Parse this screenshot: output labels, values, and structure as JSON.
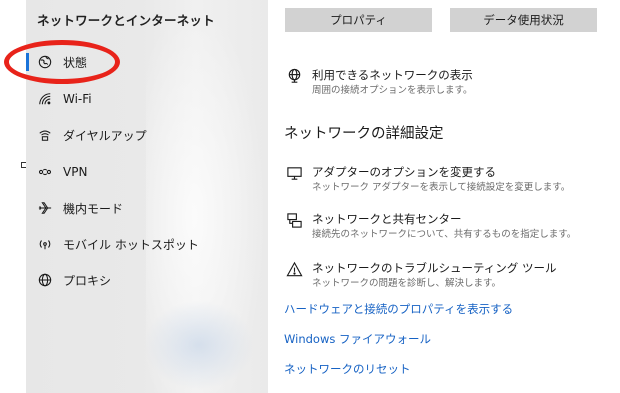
{
  "sidebar": {
    "title": "ネットワークとインターネット",
    "items": [
      {
        "label": "状態",
        "icon": "globe-status-icon",
        "active": true
      },
      {
        "label": "Wi-Fi",
        "icon": "wifi-icon"
      },
      {
        "label": "ダイヤルアップ",
        "icon": "dialup-icon"
      },
      {
        "label": "VPN",
        "icon": "vpn-icon"
      },
      {
        "label": "機内モード",
        "icon": "airplane-icon"
      },
      {
        "label": "モバイル ホットスポット",
        "icon": "hotspot-icon"
      },
      {
        "label": "プロキシ",
        "icon": "globe-icon"
      }
    ]
  },
  "toolbar": {
    "properties_label": "プロパティ",
    "data_usage_label": "データ使用状況"
  },
  "main": {
    "show_networks": {
      "title": "利用できるネットワークの表示",
      "subtitle": "周囲の接続オプションを表示します。",
      "icon": "network-list-icon"
    },
    "advanced_heading": "ネットワークの詳細設定",
    "adapter_options": {
      "title": "アダプターのオプションを変更する",
      "subtitle": "ネットワーク アダプターを表示して接続設定を変更します。",
      "icon": "monitor-icon"
    },
    "sharing_center": {
      "title": "ネットワークと共有センター",
      "subtitle": "接続先のネットワークについて、共有するものを指定します。",
      "icon": "sharing-icon"
    },
    "troubleshooter": {
      "title": "ネットワークのトラブルシューティング ツール",
      "subtitle": "ネットワークの問題を診断し、解決します。",
      "icon": "warning-icon"
    },
    "links": {
      "hardware_props": "ハードウェアと接続のプロパティを表示する",
      "firewall": "Windows ファイアウォール",
      "reset": "ネットワークのリセット"
    }
  },
  "colors": {
    "accent": "#1a73d9",
    "link": "#1662c4",
    "highlight_circle": "#e8231a",
    "button_bg": "#d2d2d2"
  }
}
